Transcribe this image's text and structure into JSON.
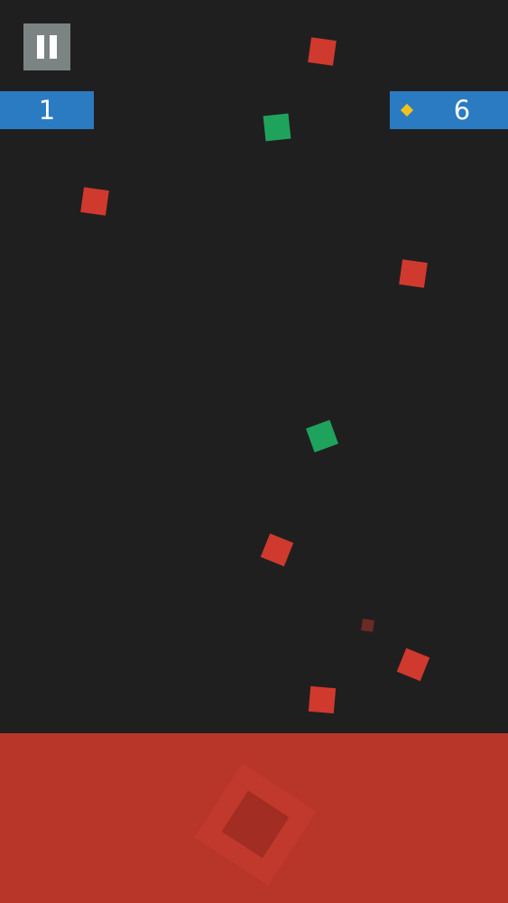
{
  "hud": {
    "score": "1",
    "gems": "6",
    "pause_icon": "pause-icon",
    "gem_icon": "diamond-icon"
  },
  "colors": {
    "background": "#201f20",
    "ground": "#b83529",
    "hud_panel": "#2a7bc2",
    "pause_button": "#7c8483",
    "red_block": "#d0392d",
    "green_block": "#1fa35c",
    "gem": "#f1c21c"
  },
  "falling_blocks": [
    {
      "color": "red"
    },
    {
      "color": "green"
    },
    {
      "color": "red"
    },
    {
      "color": "red"
    },
    {
      "color": "green"
    },
    {
      "color": "red"
    },
    {
      "color": "red",
      "faded": true
    },
    {
      "color": "red"
    },
    {
      "color": "red"
    }
  ]
}
